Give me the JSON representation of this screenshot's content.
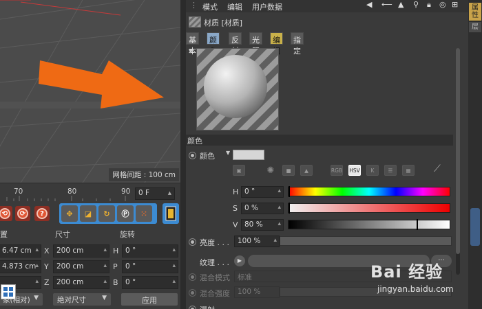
{
  "viewport": {
    "grid_spacing": "网格间距 : 100 cm"
  },
  "timeline": {
    "ticks": [
      "70",
      "80",
      "90"
    ],
    "current_frame": "0 F"
  },
  "transport": {
    "buttons": [
      "record-key",
      "auto-key",
      "help"
    ],
    "tool_group": [
      "move",
      "scale",
      "rotate",
      "P",
      "dots"
    ],
    "film": "film-icon"
  },
  "coords": {
    "headers": {
      "position": "置",
      "size": "尺寸",
      "rotation": "旋转"
    },
    "rows": [
      {
        "axis": "X",
        "pos": "6.47 cm",
        "size": "200 cm",
        "rot_axis": "H",
        "rot": "0 °"
      },
      {
        "axis": "Y",
        "pos": "4.873 cm",
        "size": "200 cm",
        "rot_axis": "P",
        "rot": "0 °"
      },
      {
        "axis": "Z",
        "pos": "",
        "size": "200 cm",
        "rot_axis": "B",
        "rot": "0 °"
      }
    ],
    "mode_left": "象(相对)",
    "mode_mid": "绝对尺寸",
    "apply": "应用"
  },
  "attr": {
    "menu": [
      "模式",
      "编辑",
      "用户数据"
    ],
    "material_title": "材质 [材质]",
    "tabs": [
      "基本",
      "颜色",
      "反射",
      "光照",
      "编辑",
      "指定"
    ],
    "section": "颜色",
    "color_label": "颜色",
    "modes": [
      "RGB",
      "HSV",
      "K"
    ],
    "hsv": {
      "h_label": "H",
      "h": "0 °",
      "s_label": "S",
      "s": "0 %",
      "v_label": "V",
      "v": "80 %",
      "v_fraction": 0.8
    },
    "brightness_label": "亮度 . . .",
    "brightness": "100 %",
    "texture_label": "纹理 . . .",
    "texture_btn": "...",
    "blend_mode_label": "混合模式",
    "blend_mode": "标准",
    "blend_strength_label": "混合强度",
    "blend_strength": "100 %",
    "bottom_label": "漫射"
  },
  "right_strip": {
    "tab1": "属性",
    "tab2": "层"
  },
  "watermark": {
    "main": "Bai 经验",
    "sub": "jingyan.baidu.com"
  }
}
